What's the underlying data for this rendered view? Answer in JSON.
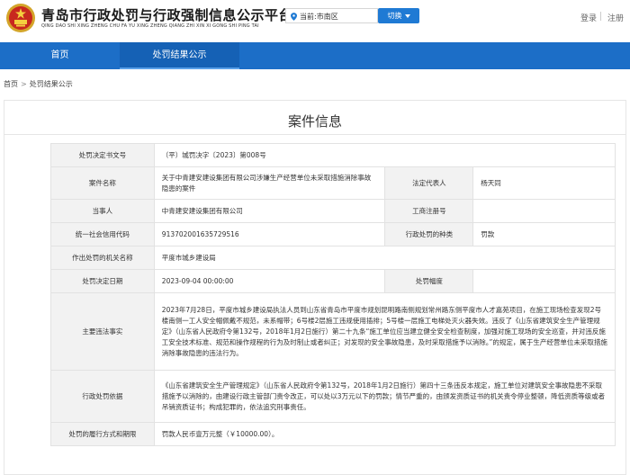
{
  "site": {
    "title": "青岛市行政处罚与行政强制信息公示平台",
    "subtitle": "QING DAO SHI XING ZHENG CHU FA YU XING ZHENG QIANG ZHI XIN XI GONG SHI PING TAI",
    "location_label": "当前:市南区",
    "switch_label": "切换",
    "login": "登录",
    "register": "注册"
  },
  "nav": {
    "home": "首页",
    "results": "处罚结果公示"
  },
  "breadcrumb": {
    "home": "首页",
    "sep": ">",
    "current": "处罚结果公示"
  },
  "panel": {
    "title": "案件信息"
  },
  "case": {
    "doc_no_label": "处罚决定书文号",
    "doc_no": "（平）城罚决字〔2023〕第008号",
    "case_name_label": "案件名称",
    "case_name": "关于中青建安建设集团有限公司涉嫌生产经营单位未采取措施消除事故隐患的案件",
    "legal_rep_label": "法定代表人",
    "legal_rep": "杨天同",
    "party_label": "当事人",
    "party": "中青建安建设集团有限公司",
    "reg_no_label": "工商注册号",
    "reg_no": "",
    "credit_code_label": "统一社会信用代码",
    "credit_code": "913702001635729516",
    "penalty_type_label": "行政处罚的种类",
    "penalty_type": "罚款",
    "authority_label": "作出处罚的机关名称",
    "authority": "平度市城乡建设局",
    "date_label": "处罚决定日期",
    "date": "2023-09-04 00:00:00",
    "amount_label": "处罚幅度",
    "amount": "",
    "facts_label": "主要违法事实",
    "facts": "2023年7月28日，平度市城乡建设局执法人员到山东省青岛市平度市规划昆明路南侧规划常州路东侧平度市人才嘉苑项目，在施工现场检查发现2号楼南侧一工人安全帽佩戴不规范，未系帽带；6号楼2层施工违规使用插排；5号楼一层施工电梯处灭火器失效。违反了《山东省建筑安全生产管理规定》（山东省人民政府令第132号，2018年1月2日施行）第二十九条“施工单位应当建立健全安全检查制度，加强对施工现场的安全巡查，并对违反施工安全技术标准、规范和操作规程的行为及时制止或者纠正；对发现的安全事故隐患，及时采取措施予以消除。”的规定，属于生产经营单位未采取措施消除事故隐患的违法行为。",
    "basis_label": "行政处罚依据",
    "basis": "《山东省建筑安全生产管理规定》（山东省人民政府令第132号，2018年1月2日施行）第四十三条违反本规定，施工单位对建筑安全事故隐患不采取措施予以消除的，由建设行政主管部门责令改正，可以处以3万元以下的罚款；情节严重的，由颁发资质证书的机关责令停业整顿，降低资质等级或者吊销资质证书；构成犯罪的，依法追究刑事责任。",
    "performance_label": "处罚的履行方式和期限",
    "performance": "罚款人民币壹万元整（￥10000.00）。"
  }
}
